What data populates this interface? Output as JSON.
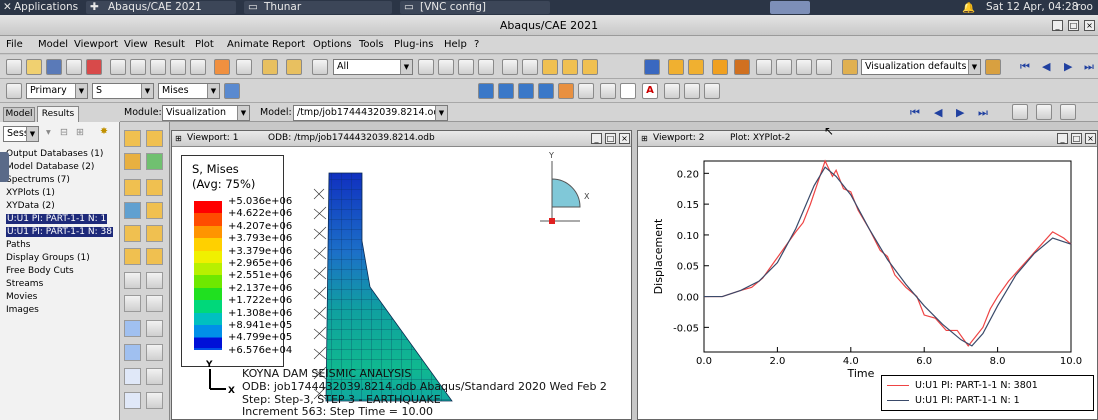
{
  "taskbar": {
    "applications": "Applications",
    "task1": "Abaqus/CAE 2021",
    "task2": "Thunar",
    "task3": "[VNC config]",
    "clock": "Sat 12 Apr, 04:28",
    "user": "roo"
  },
  "window": {
    "title": "Abaqus/CAE 2021"
  },
  "menu": [
    "File",
    "Model",
    "Viewport",
    "View",
    "Result",
    "Plot",
    "Animate",
    "Report",
    "Options",
    "Tools",
    "Plug-ins",
    "Help",
    "?"
  ],
  "toolbar1": {
    "display_group": "All",
    "view_defaults": "Visualization defaults"
  },
  "toolbar2": {
    "field_primary": "Primary",
    "field_var": "S",
    "field_inv": "Mises"
  },
  "context": {
    "module_label": "Module:",
    "module_value": "Visualization",
    "model_label": "Model:",
    "model_value": "/tmp/job1744432039.8214.odb"
  },
  "tabs": {
    "model": "Model",
    "results": "Results"
  },
  "session": "Sessi",
  "tree": [
    "Output Databases (1)",
    "Model Database (2)",
    "Spectrums (7)",
    "XYPlots (1)",
    "XYData (2)",
    "U:U1 PI: PART-1-1 N: 1",
    "U:U1 PI: PART-1-1 N: 38",
    "Paths",
    "Display Groups (1)",
    "Free Body Cuts",
    "Streams",
    "Movies",
    "Images"
  ],
  "viewport1": {
    "title": "Viewport: 1",
    "odb": "ODB: /tmp/job1744432039.8214.odb"
  },
  "viewport2": {
    "title": "Viewport: 2",
    "plot": "Plot: XYPlot-2"
  },
  "contour_legend": {
    "title": "S, Mises",
    "subtitle": "(Avg: 75%)",
    "values": [
      "+5.036e+06",
      "+4.622e+06",
      "+4.207e+06",
      "+3.793e+06",
      "+3.379e+06",
      "+2.965e+06",
      "+2.551e+06",
      "+2.137e+06",
      "+1.722e+06",
      "+1.308e+06",
      "+8.941e+05",
      "+4.799e+05",
      "+6.576e+04"
    ],
    "colors": [
      "#ff0000",
      "#ff4c00",
      "#ff9400",
      "#ffd000",
      "#f0f000",
      "#b8f000",
      "#6ee800",
      "#20e020",
      "#00d87a",
      "#00c0c0",
      "#0090e8",
      "#0050e8",
      "#0010d8"
    ]
  },
  "triad": {
    "y": "Y",
    "x": "X"
  },
  "info_block": {
    "line1": "KOYNA DAM SEISMIC ANALYSIS",
    "line2": "ODB: job1744432039.8214.odb    Abaqus/Standard 2020    Wed Feb 2",
    "line3": "Step: Step-3, STEP 3 - EARTHQUAKE",
    "line4": "Increment    563: Step Time =     10.00"
  },
  "chart_data": {
    "type": "line",
    "xlabel": "Time",
    "ylabel": "Displacement",
    "xlim": [
      0,
      10
    ],
    "ylim": [
      -0.09,
      0.22
    ],
    "xticks": [
      "0.0",
      "2.0",
      "4.0",
      "6.0",
      "8.0",
      "10.0"
    ],
    "yticks": [
      "0.20",
      "0.15",
      "0.10",
      "0.05",
      "0.00",
      "-0.05"
    ],
    "series": [
      {
        "name": "U:U1 PI: PART-1-1 N: 3801",
        "color": "#ee4444",
        "x": [
          0,
          0.5,
          1.0,
          1.3,
          1.6,
          1.9,
          2.2,
          2.5,
          2.7,
          2.9,
          3.1,
          3.3,
          3.5,
          3.6,
          3.8,
          4.0,
          4.2,
          4.5,
          4.8,
          5.0,
          5.2,
          5.5,
          5.8,
          6.0,
          6.3,
          6.6,
          6.9,
          7.2,
          7.4,
          7.6,
          7.8,
          8.0,
          8.3,
          8.6,
          8.9,
          9.2,
          9.5,
          9.8,
          10.0
        ],
        "y": [
          0.0,
          0.0,
          0.01,
          0.015,
          0.03,
          0.055,
          0.08,
          0.105,
          0.12,
          0.15,
          0.185,
          0.22,
          0.195,
          0.205,
          0.175,
          0.17,
          0.14,
          0.11,
          0.075,
          0.065,
          0.035,
          0.015,
          0.0,
          -0.03,
          -0.035,
          -0.055,
          -0.055,
          -0.08,
          -0.065,
          -0.05,
          -0.02,
          0.0,
          0.025,
          0.045,
          0.065,
          0.085,
          0.105,
          0.095,
          0.085
        ]
      },
      {
        "name": "U:U1 PI: PART-1-1 N: 1",
        "color": "#3a4a6a",
        "x": [
          0,
          0.5,
          1.0,
          1.5,
          2.0,
          2.5,
          3.0,
          3.3,
          3.6,
          4.0,
          4.5,
          5.0,
          5.5,
          6.0,
          6.5,
          7.0,
          7.3,
          7.6,
          8.0,
          8.5,
          9.0,
          9.5,
          10.0
        ],
        "y": [
          0.0,
          0.0,
          0.01,
          0.025,
          0.055,
          0.11,
          0.18,
          0.21,
          0.195,
          0.165,
          0.11,
          0.06,
          0.02,
          -0.015,
          -0.045,
          -0.07,
          -0.08,
          -0.06,
          -0.015,
          0.035,
          0.07,
          0.095,
          0.085
        ]
      }
    ]
  }
}
